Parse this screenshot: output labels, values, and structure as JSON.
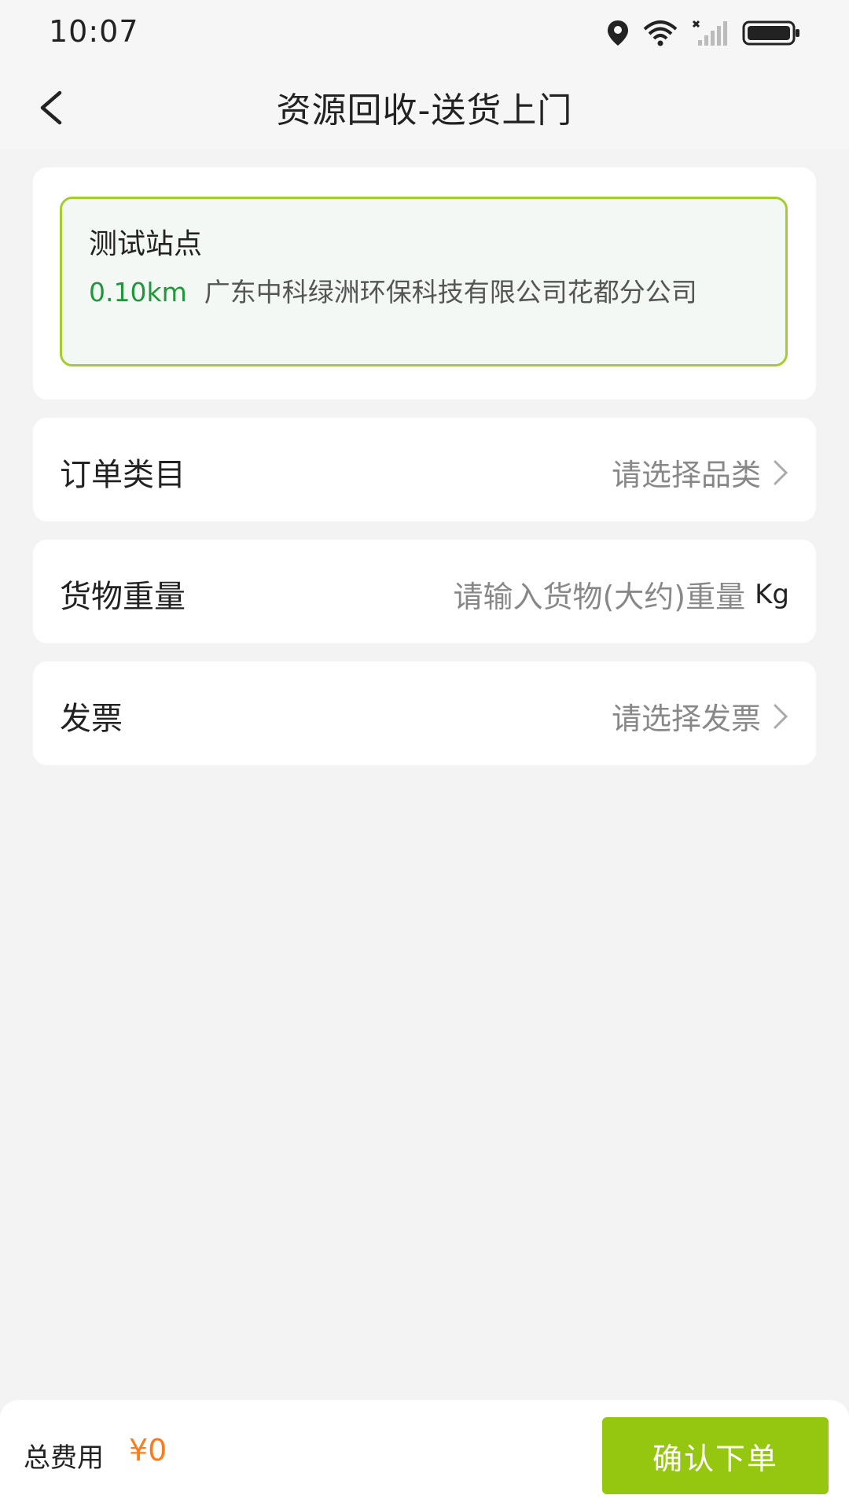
{
  "status_bar": {
    "time": "10:07"
  },
  "header": {
    "title": "资源回收-送货上门"
  },
  "station": {
    "name": "测试站点",
    "distance": "0.10km",
    "address": "广东中科绿洲环保科技有限公司花都分公司"
  },
  "form": {
    "category": {
      "label": "订单类目",
      "placeholder": "请选择品类"
    },
    "weight": {
      "label": "货物重量",
      "placeholder": "请输入货物(大约)重量",
      "unit": "Kg"
    },
    "invoice": {
      "label": "发票",
      "placeholder": "请选择发票"
    }
  },
  "footer": {
    "total_label": "总费用",
    "total_value": "¥0",
    "confirm_label": "确认下单"
  },
  "colors": {
    "accent_green": "#96c710",
    "distance_green": "#20973a",
    "price_orange": "#ff7a1a",
    "station_border": "#a3cc2c"
  }
}
